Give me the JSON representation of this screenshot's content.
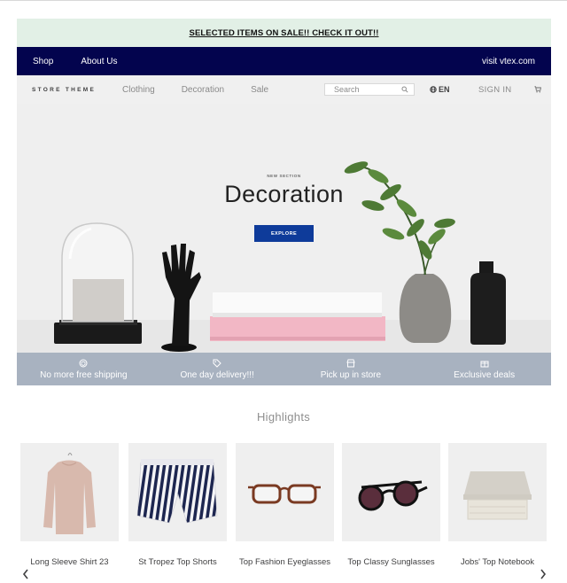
{
  "promo": {
    "text": "SELECTED ITEMS ON SALE!! CHECK IT OUT!!"
  },
  "topbar": {
    "links": [
      {
        "label": "Shop"
      },
      {
        "label": "About Us"
      }
    ],
    "right_link": "visit vtex.com",
    "background": "#03044e"
  },
  "nav": {
    "logo": "STORE THEME",
    "links": [
      {
        "label": "Clothing"
      },
      {
        "label": "Decoration"
      },
      {
        "label": "Sale"
      }
    ],
    "search": {
      "placeholder": "Search",
      "icon": "search-icon"
    },
    "language": "EN",
    "language_icon": "globe-icon",
    "signin": "SIGN IN",
    "cart_icon": "cart-icon"
  },
  "hero": {
    "kicker": "NEW SECTION",
    "title": "Decoration",
    "button": "EXPLORE",
    "button_color": "#0e3b9a"
  },
  "features": {
    "background": "#a8b2c0",
    "items": [
      {
        "label": "No more free shipping",
        "icon": "box-icon"
      },
      {
        "label": "One day delivery!!!",
        "icon": "tag-icon"
      },
      {
        "label": "Pick up in store",
        "icon": "store-icon"
      },
      {
        "label": "Exclusive deals",
        "icon": "gift-icon"
      }
    ]
  },
  "highlights": {
    "title": "Highlights",
    "products": [
      {
        "name": "Long Sleeve Shirt 23"
      },
      {
        "name": "St Tropez Top Shorts"
      },
      {
        "name": "Top Fashion Eyeglasses"
      },
      {
        "name": "Top Classy Sunglasses"
      },
      {
        "name": "Jobs' Top Notebook"
      }
    ],
    "prev_icon": "chevron-left-icon",
    "next_icon": "chevron-right-icon"
  }
}
